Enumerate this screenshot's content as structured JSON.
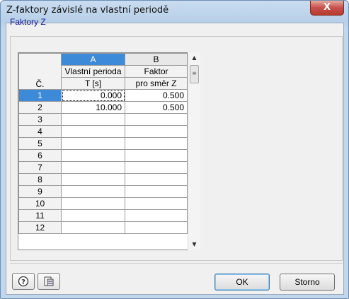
{
  "window": {
    "title": "Z-faktory závislé na vlastní periodě",
    "close_glyph": "X"
  },
  "group": {
    "label": "Faktory Z"
  },
  "grid": {
    "corner_label": "Č.",
    "columns": [
      {
        "letter": "A",
        "line1": "Vlastní perioda",
        "line2": "T [s]"
      },
      {
        "letter": "B",
        "line1": "Faktor",
        "line2": "pro směr Z"
      }
    ],
    "rows": [
      {
        "num": "1",
        "a": "0.000",
        "b": "0.500"
      },
      {
        "num": "2",
        "a": "10.000",
        "b": "0.500"
      },
      {
        "num": "3",
        "a": "",
        "b": ""
      },
      {
        "num": "4",
        "a": "",
        "b": ""
      },
      {
        "num": "5",
        "a": "",
        "b": ""
      },
      {
        "num": "6",
        "a": "",
        "b": ""
      },
      {
        "num": "7",
        "a": "",
        "b": ""
      },
      {
        "num": "8",
        "a": "",
        "b": ""
      },
      {
        "num": "9",
        "a": "",
        "b": ""
      },
      {
        "num": "10",
        "a": "",
        "b": ""
      },
      {
        "num": "11",
        "a": "",
        "b": ""
      },
      {
        "num": "12",
        "a": "",
        "b": ""
      }
    ]
  },
  "icons": {
    "help": "help-icon",
    "export": "table-export-icon"
  },
  "buttons": {
    "ok": "OK",
    "cancel": "Storno"
  },
  "colors": {
    "selection": "#3c8ad8",
    "group_label": "#1a1a8c"
  }
}
